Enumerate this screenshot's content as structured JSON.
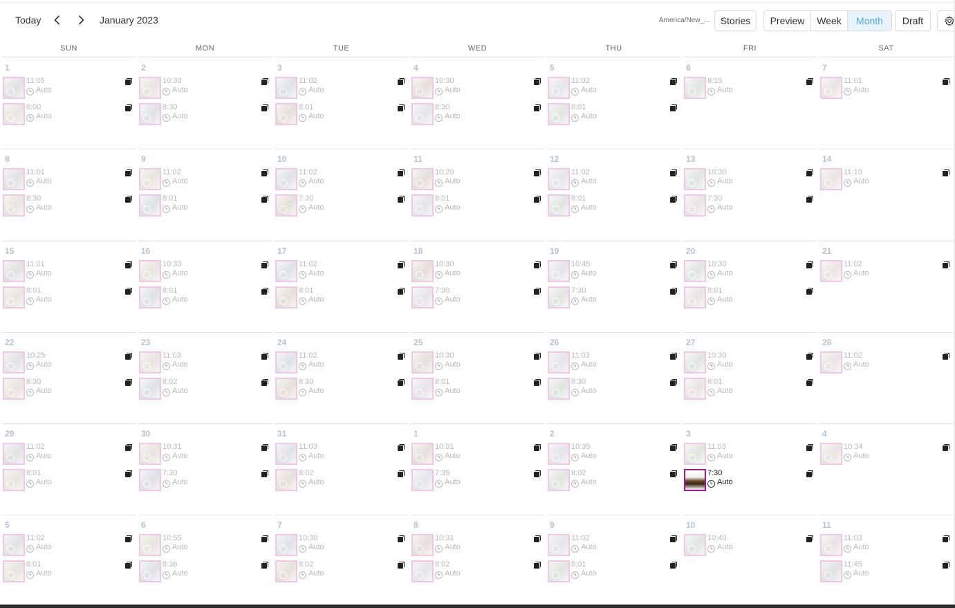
{
  "header": {
    "today_label": "Today",
    "month_title": "January 2023",
    "timezone": "America/New_...",
    "stories_label": "Stories",
    "preview_label": "Preview",
    "week_label": "Week",
    "month_label": "Month",
    "draft_label": "Draft",
    "active_view": "Month"
  },
  "colors": {
    "accent": "#4aa9e0",
    "thumb_border": "#e79ad5",
    "active_thumb_border": "#b0148f",
    "day_number": "#b5c2d3"
  },
  "weekdays": [
    "SUN",
    "MON",
    "TUE",
    "WED",
    "THU",
    "FRI",
    "SAT"
  ],
  "weeks": [
    [
      {
        "day": "1",
        "posts": [
          {
            "time": "11:05",
            "mode": "Auto"
          },
          {
            "time": "8:00",
            "mode": "Auto"
          }
        ]
      },
      {
        "day": "2",
        "posts": [
          {
            "time": "10:30",
            "mode": "Auto"
          },
          {
            "time": "8:30",
            "mode": "Auto"
          }
        ]
      },
      {
        "day": "3",
        "posts": [
          {
            "time": "11:02",
            "mode": "Auto"
          },
          {
            "time": "8:01",
            "mode": "Auto"
          }
        ]
      },
      {
        "day": "4",
        "posts": [
          {
            "time": "10:30",
            "mode": "Auto"
          },
          {
            "time": "8:30",
            "mode": "Auto"
          }
        ]
      },
      {
        "day": "5",
        "posts": [
          {
            "time": "11:02",
            "mode": "Auto"
          },
          {
            "time": "8:01",
            "mode": "Auto"
          }
        ]
      },
      {
        "day": "6",
        "posts": [
          {
            "time": "8:15",
            "mode": "Auto"
          }
        ]
      },
      {
        "day": "7",
        "posts": [
          {
            "time": "11:01",
            "mode": "Auto"
          }
        ]
      }
    ],
    [
      {
        "day": "8",
        "posts": [
          {
            "time": "11:01",
            "mode": "Auto"
          },
          {
            "time": "8:30",
            "mode": "Auto"
          }
        ]
      },
      {
        "day": "9",
        "posts": [
          {
            "time": "11:02",
            "mode": "Auto"
          },
          {
            "time": "8:01",
            "mode": "Auto"
          }
        ]
      },
      {
        "day": "10",
        "posts": [
          {
            "time": "11:02",
            "mode": "Auto"
          },
          {
            "time": "7:30",
            "mode": "Auto"
          }
        ]
      },
      {
        "day": "11",
        "posts": [
          {
            "time": "10:20",
            "mode": "Auto"
          },
          {
            "time": "8:01",
            "mode": "Auto"
          }
        ]
      },
      {
        "day": "12",
        "posts": [
          {
            "time": "11:02",
            "mode": "Auto"
          },
          {
            "time": "8:01",
            "mode": "Auto"
          }
        ]
      },
      {
        "day": "13",
        "posts": [
          {
            "time": "10:30",
            "mode": "Auto"
          },
          {
            "time": "7:30",
            "mode": "Auto"
          }
        ]
      },
      {
        "day": "14",
        "posts": [
          {
            "time": "11:10",
            "mode": "Auto"
          }
        ]
      }
    ],
    [
      {
        "day": "15",
        "posts": [
          {
            "time": "11:01",
            "mode": "Auto"
          },
          {
            "time": "8:01",
            "mode": "Auto"
          }
        ]
      },
      {
        "day": "16",
        "posts": [
          {
            "time": "10:33",
            "mode": "Auto"
          },
          {
            "time": "8:01",
            "mode": "Auto"
          }
        ]
      },
      {
        "day": "17",
        "posts": [
          {
            "time": "11:02",
            "mode": "Auto"
          },
          {
            "time": "8:01",
            "mode": "Auto"
          }
        ]
      },
      {
        "day": "18",
        "posts": [
          {
            "time": "10:30",
            "mode": "Auto"
          },
          {
            "time": "7:30",
            "mode": "Auto"
          }
        ]
      },
      {
        "day": "19",
        "posts": [
          {
            "time": "10:45",
            "mode": "Auto"
          },
          {
            "time": "7:30",
            "mode": "Auto"
          }
        ]
      },
      {
        "day": "20",
        "posts": [
          {
            "time": "10:30",
            "mode": "Auto"
          },
          {
            "time": "8:01",
            "mode": "Auto"
          }
        ]
      },
      {
        "day": "21",
        "posts": [
          {
            "time": "11:02",
            "mode": "Auto"
          }
        ]
      }
    ],
    [
      {
        "day": "22",
        "posts": [
          {
            "time": "10:25",
            "mode": "Auto"
          },
          {
            "time": "8:30",
            "mode": "Auto"
          }
        ]
      },
      {
        "day": "23",
        "posts": [
          {
            "time": "11:03",
            "mode": "Auto"
          },
          {
            "time": "8:02",
            "mode": "Auto"
          }
        ]
      },
      {
        "day": "24",
        "posts": [
          {
            "time": "11:02",
            "mode": "Auto"
          },
          {
            "time": "8:30",
            "mode": "Auto"
          }
        ]
      },
      {
        "day": "25",
        "posts": [
          {
            "time": "10:30",
            "mode": "Auto"
          },
          {
            "time": "8:01",
            "mode": "Auto"
          }
        ]
      },
      {
        "day": "26",
        "posts": [
          {
            "time": "11:03",
            "mode": "Auto"
          },
          {
            "time": "8:30",
            "mode": "Auto"
          }
        ]
      },
      {
        "day": "27",
        "posts": [
          {
            "time": "10:30",
            "mode": "Auto"
          },
          {
            "time": "8:01",
            "mode": "Auto"
          }
        ]
      },
      {
        "day": "28",
        "posts": [
          {
            "time": "11:02",
            "mode": "Auto"
          }
        ]
      }
    ],
    [
      {
        "day": "29",
        "posts": [
          {
            "time": "11:02",
            "mode": "Auto"
          },
          {
            "time": "8:01",
            "mode": "Auto"
          }
        ]
      },
      {
        "day": "30",
        "posts": [
          {
            "time": "10:31",
            "mode": "Auto"
          },
          {
            "time": "7:30",
            "mode": "Auto"
          }
        ]
      },
      {
        "day": "31",
        "posts": [
          {
            "time": "11:03",
            "mode": "Auto"
          },
          {
            "time": "8:02",
            "mode": "Auto"
          }
        ]
      },
      {
        "day": "1",
        "posts": [
          {
            "time": "10:31",
            "mode": "Auto"
          },
          {
            "time": "7:35",
            "mode": "Auto"
          }
        ]
      },
      {
        "day": "2",
        "posts": [
          {
            "time": "10:35",
            "mode": "Auto"
          },
          {
            "time": "8:02",
            "mode": "Auto"
          }
        ]
      },
      {
        "day": "3",
        "posts": [
          {
            "time": "11:03",
            "mode": "Auto"
          },
          {
            "time": "7:30",
            "mode": "Auto",
            "active": true
          }
        ]
      },
      {
        "day": "4",
        "posts": [
          {
            "time": "10:34",
            "mode": "Auto"
          }
        ]
      }
    ],
    [
      {
        "day": "5",
        "posts": [
          {
            "time": "11:02",
            "mode": "Auto"
          },
          {
            "time": "8:01",
            "mode": "Auto"
          }
        ]
      },
      {
        "day": "6",
        "posts": [
          {
            "time": "10:55",
            "mode": "Auto"
          },
          {
            "time": "8:36",
            "mode": "Auto"
          }
        ]
      },
      {
        "day": "7",
        "posts": [
          {
            "time": "10:30",
            "mode": "Auto"
          },
          {
            "time": "8:02",
            "mode": "Auto"
          }
        ]
      },
      {
        "day": "8",
        "posts": [
          {
            "time": "10:31",
            "mode": "Auto"
          },
          {
            "time": "8:02",
            "mode": "Auto"
          }
        ]
      },
      {
        "day": "9",
        "posts": [
          {
            "time": "11:02",
            "mode": "Auto"
          },
          {
            "time": "8:01",
            "mode": "Auto"
          }
        ]
      },
      {
        "day": "10",
        "posts": [
          {
            "time": "10:40",
            "mode": "Auto"
          }
        ]
      },
      {
        "day": "11",
        "posts": [
          {
            "time": "11:03",
            "mode": "Auto"
          },
          {
            "time": "11:45",
            "mode": "Auto"
          }
        ]
      }
    ]
  ]
}
